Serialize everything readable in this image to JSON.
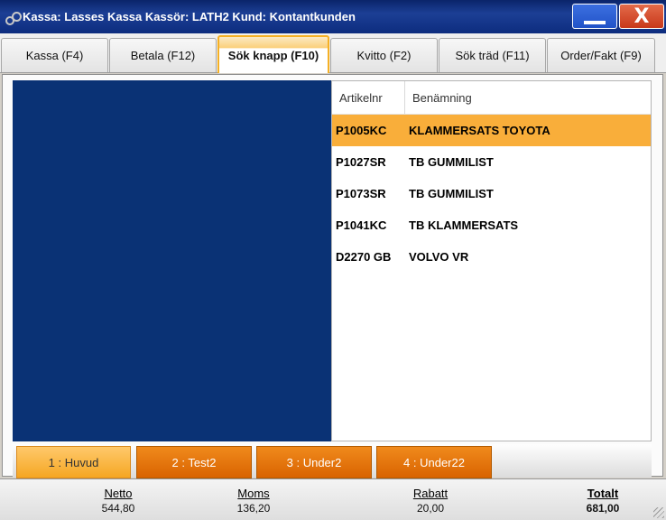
{
  "window": {
    "title": "Kassa: Lasses Kassa  Kassör: LATH2  Kund: Kontantkunden",
    "close_label": "X"
  },
  "tabs": [
    {
      "label": "Kassa (F4)"
    },
    {
      "label": "Betala (F12)"
    },
    {
      "label": "Sök knapp (F10)",
      "active": true
    },
    {
      "label": "Kvitto (F2)"
    },
    {
      "label": "Sök träd (F11)"
    },
    {
      "label": "Order/Fakt (F9)"
    }
  ],
  "results": {
    "columns": [
      "Artikelnr",
      "Benämning"
    ],
    "rows": [
      {
        "artikelnr": "P1005KC",
        "benamning": "KLAMMERSATS TOYOTA",
        "selected": true
      },
      {
        "artikelnr": "P1027SR",
        "benamning": "TB GUMMILIST"
      },
      {
        "artikelnr": "P1073SR",
        "benamning": "TB GUMMILIST"
      },
      {
        "artikelnr": "P1041KC",
        "benamning": "TB KLAMMERSATS"
      },
      {
        "artikelnr": "D2270 GB",
        "benamning": "VOLVO VR"
      }
    ]
  },
  "button_groups": [
    {
      "label": "1 : Huvud",
      "active": true
    },
    {
      "label": "2 : Test2"
    },
    {
      "label": "3 : Under2"
    },
    {
      "label": "4 : Under22"
    }
  ],
  "totals": {
    "netto": {
      "label": "Netto",
      "value": "544,80"
    },
    "moms": {
      "label": "Moms",
      "value": "136,20"
    },
    "rabatt": {
      "label": "Rabatt",
      "value": "20,00"
    },
    "totalt": {
      "label": "Totalt",
      "value": "681,00"
    }
  },
  "colors": {
    "title_bar": "#0a246a",
    "panel_blue": "#0a3275",
    "selected_row": "#f9ae3a",
    "orange_button": "#e07009",
    "active_tab_border": "#f5b024"
  }
}
